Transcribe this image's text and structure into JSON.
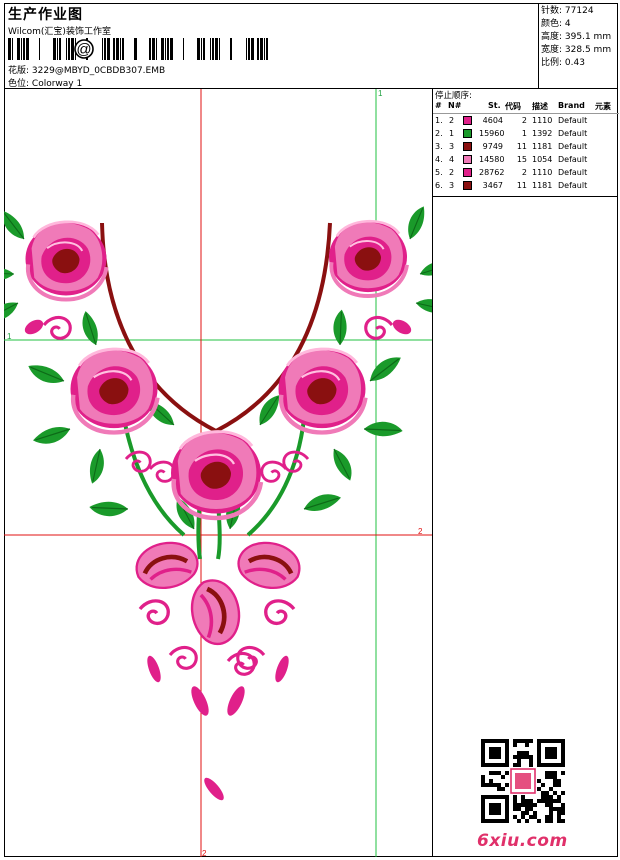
{
  "header": {
    "title": "生产作业图",
    "studio": "Wilcom(汇宝)装饰工作室",
    "at_symbol": "@",
    "design_label": "花版:",
    "design_value": "3229@MBYD_0CBDB307.EMB",
    "colorway_label": "色位:",
    "colorway_value": "Colorway 1"
  },
  "stats": {
    "stitches_label": "针数:",
    "stitches": "77124",
    "colors_label": "颜色:",
    "colors": "4",
    "height_label": "高度:",
    "height": "395.1 mm",
    "width_label": "宽度:",
    "width": "328.5 mm",
    "scale_label": "比例:",
    "scale": "0.43"
  },
  "stop_sequence": {
    "title": "停止顺序:",
    "columns": [
      "#",
      "N#",
      "St.",
      "代码",
      "描述",
      "Brand",
      "元素"
    ],
    "rows": [
      {
        "idx": "1.",
        "n": "2",
        "color": "#e0208a",
        "st": "4604",
        "code": "2",
        "desc": "1110",
        "brand": "Default"
      },
      {
        "idx": "2.",
        "n": "1",
        "color": "#1a9a2a",
        "st": "15960",
        "code": "1",
        "desc": "1392",
        "brand": "Default"
      },
      {
        "idx": "3.",
        "n": "3",
        "color": "#8a1010",
        "st": "9749",
        "code": "11",
        "desc": "1181",
        "brand": "Default"
      },
      {
        "idx": "4.",
        "n": "4",
        "color": "#f07ab8",
        "st": "14580",
        "code": "15",
        "desc": "1054",
        "brand": "Default"
      },
      {
        "idx": "5.",
        "n": "2",
        "color": "#e0208a",
        "st": "28762",
        "code": "2",
        "desc": "1110",
        "brand": "Default"
      },
      {
        "idx": "6.",
        "n": "3",
        "color": "#8a1010",
        "st": "3467",
        "code": "11",
        "desc": "1181",
        "brand": "Default"
      }
    ]
  },
  "guides": {
    "v1": "1",
    "h1": "1",
    "h2": "2",
    "v2": "2"
  },
  "watermark": {
    "text": "6xiu.com",
    "stamp_icon": "qr-code-icon"
  },
  "colors": {
    "rose": "#e0208a",
    "leaf": "#1a9a2a",
    "dark": "#8a1010",
    "light_pink": "#f07ab8",
    "guide_red": "#e01010",
    "guide_green": "#20c040"
  }
}
